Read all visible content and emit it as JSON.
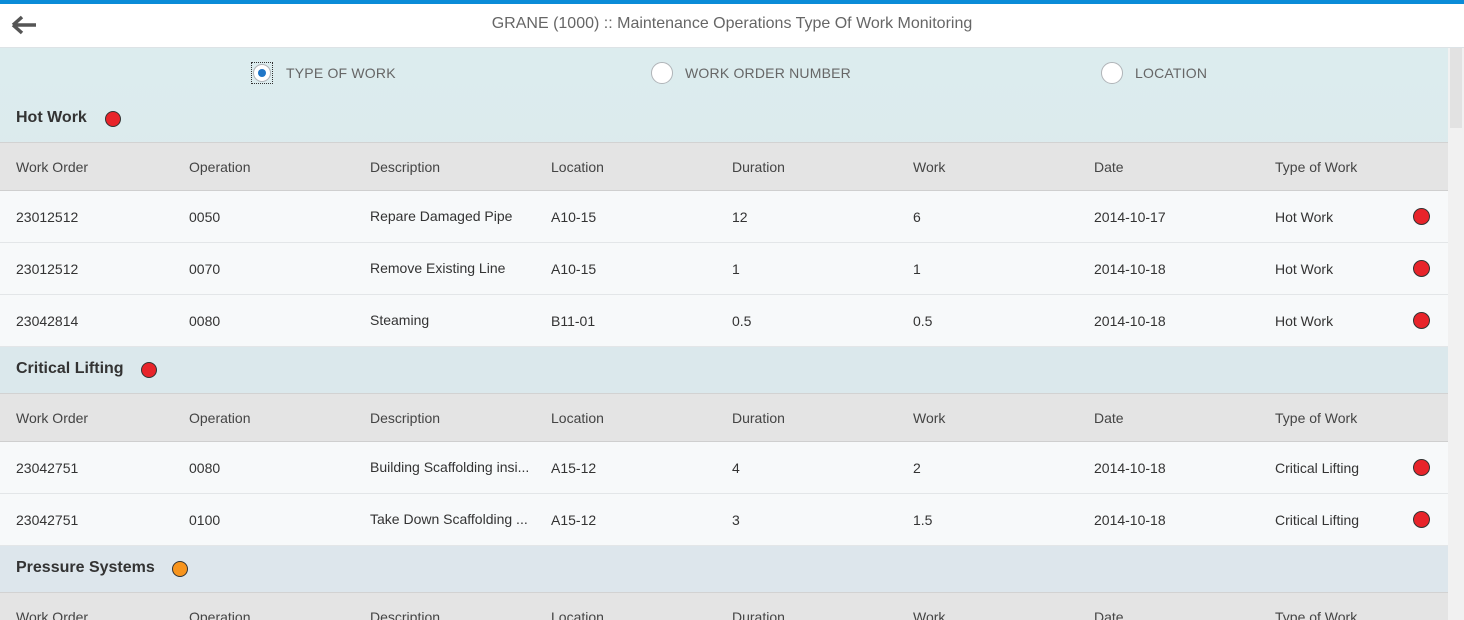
{
  "header": {
    "title": "GRANE (1000) :: Maintenance Operations Type Of Work Monitoring"
  },
  "colors": {
    "accent": "#0a8cd8",
    "critical": "#e8242a",
    "warning": "#f7941d",
    "radio": "#1f76c7"
  },
  "filter": {
    "options": [
      {
        "label": "TYPE OF WORK",
        "selected": true
      },
      {
        "label": "WORK ORDER NUMBER",
        "selected": false
      },
      {
        "label": "LOCATION",
        "selected": false
      }
    ]
  },
  "columns": [
    "Work Order",
    "Operation",
    "Description",
    "Location",
    "Duration",
    "Work",
    "Date",
    "Type of Work"
  ],
  "groups": [
    {
      "title": "Hot Work",
      "status": "red",
      "rows": [
        {
          "work_order": "23012512",
          "operation": "0050",
          "description": "Repare Damaged Pipe",
          "location": "A10-15",
          "duration": "12",
          "work": "6",
          "date": "2014-10-17",
          "type": "Hot Work",
          "status": "red"
        },
        {
          "work_order": "23012512",
          "operation": "0070",
          "description": "Remove Existing Line",
          "location": "A10-15",
          "duration": "1",
          "work": "1",
          "date": "2014-10-18",
          "type": "Hot Work",
          "status": "red"
        },
        {
          "work_order": "23042814",
          "operation": "0080",
          "description": "Steaming",
          "location": "B11-01",
          "duration": "0.5",
          "work": "0.5",
          "date": "2014-10-18",
          "type": "Hot Work",
          "status": "red"
        }
      ]
    },
    {
      "title": "Critical Lifting",
      "status": "red",
      "rows": [
        {
          "work_order": "23042751",
          "operation": "0080",
          "description": "Building Scaffolding insi...",
          "location": "A15-12",
          "duration": "4",
          "work": "2",
          "date": "2014-10-18",
          "type": "Critical Lifting",
          "status": "red"
        },
        {
          "work_order": "23042751",
          "operation": "0100",
          "description": "Take Down Scaffolding ...",
          "location": "A15-12",
          "duration": "3",
          "work": "1.5",
          "date": "2014-10-18",
          "type": "Critical Lifting",
          "status": "red"
        }
      ]
    },
    {
      "title": "Pressure Systems",
      "status": "orange",
      "rows": []
    }
  ]
}
